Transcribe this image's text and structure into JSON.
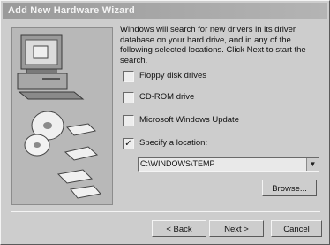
{
  "window": {
    "title": "Add New Hardware Wizard"
  },
  "intro_text": "Windows will search for new drivers in its driver database on your hard drive, and in any of the following selected locations. Click Next to start the search.",
  "options": [
    {
      "label": "Floppy disk drives",
      "checked": false
    },
    {
      "label": "CD-ROM drive",
      "checked": false
    },
    {
      "label": "Microsoft Windows Update",
      "checked": false
    },
    {
      "label": "Specify a location:",
      "checked": true
    }
  ],
  "location": {
    "value": "C:\\WINDOWS\\TEMP"
  },
  "buttons": {
    "browse": "Browse...",
    "back": "< Back",
    "next": "Next >",
    "cancel": "Cancel"
  }
}
